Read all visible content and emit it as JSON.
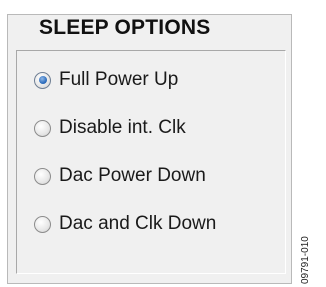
{
  "group": {
    "title": "SLEEP OPTIONS",
    "options": [
      {
        "label": "Full Power Up",
        "checked": true
      },
      {
        "label": "Disable int. Clk",
        "checked": false
      },
      {
        "label": "Dac Power Down",
        "checked": false
      },
      {
        "label": "Dac and Clk Down",
        "checked": false
      }
    ],
    "selected": "Full Power Up"
  },
  "figure_tag": "09791-010",
  "colors": {
    "panel_bg": "#f0f0f0",
    "radio_selected": "#2f6fbf"
  }
}
